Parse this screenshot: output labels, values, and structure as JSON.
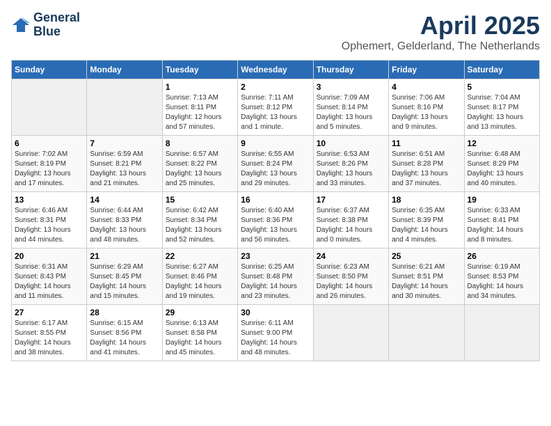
{
  "header": {
    "logo_line1": "General",
    "logo_line2": "Blue",
    "title": "April 2025",
    "subtitle": "Ophemert, Gelderland, The Netherlands"
  },
  "weekdays": [
    "Sunday",
    "Monday",
    "Tuesday",
    "Wednesday",
    "Thursday",
    "Friday",
    "Saturday"
  ],
  "weeks": [
    [
      {
        "num": "",
        "info": ""
      },
      {
        "num": "",
        "info": ""
      },
      {
        "num": "1",
        "info": "Sunrise: 7:13 AM\nSunset: 8:11 PM\nDaylight: 12 hours\nand 57 minutes."
      },
      {
        "num": "2",
        "info": "Sunrise: 7:11 AM\nSunset: 8:12 PM\nDaylight: 13 hours\nand 1 minute."
      },
      {
        "num": "3",
        "info": "Sunrise: 7:09 AM\nSunset: 8:14 PM\nDaylight: 13 hours\nand 5 minutes."
      },
      {
        "num": "4",
        "info": "Sunrise: 7:06 AM\nSunset: 8:16 PM\nDaylight: 13 hours\nand 9 minutes."
      },
      {
        "num": "5",
        "info": "Sunrise: 7:04 AM\nSunset: 8:17 PM\nDaylight: 13 hours\nand 13 minutes."
      }
    ],
    [
      {
        "num": "6",
        "info": "Sunrise: 7:02 AM\nSunset: 8:19 PM\nDaylight: 13 hours\nand 17 minutes."
      },
      {
        "num": "7",
        "info": "Sunrise: 6:59 AM\nSunset: 8:21 PM\nDaylight: 13 hours\nand 21 minutes."
      },
      {
        "num": "8",
        "info": "Sunrise: 6:57 AM\nSunset: 8:22 PM\nDaylight: 13 hours\nand 25 minutes."
      },
      {
        "num": "9",
        "info": "Sunrise: 6:55 AM\nSunset: 8:24 PM\nDaylight: 13 hours\nand 29 minutes."
      },
      {
        "num": "10",
        "info": "Sunrise: 6:53 AM\nSunset: 8:26 PM\nDaylight: 13 hours\nand 33 minutes."
      },
      {
        "num": "11",
        "info": "Sunrise: 6:51 AM\nSunset: 8:28 PM\nDaylight: 13 hours\nand 37 minutes."
      },
      {
        "num": "12",
        "info": "Sunrise: 6:48 AM\nSunset: 8:29 PM\nDaylight: 13 hours\nand 40 minutes."
      }
    ],
    [
      {
        "num": "13",
        "info": "Sunrise: 6:46 AM\nSunset: 8:31 PM\nDaylight: 13 hours\nand 44 minutes."
      },
      {
        "num": "14",
        "info": "Sunrise: 6:44 AM\nSunset: 8:33 PM\nDaylight: 13 hours\nand 48 minutes."
      },
      {
        "num": "15",
        "info": "Sunrise: 6:42 AM\nSunset: 8:34 PM\nDaylight: 13 hours\nand 52 minutes."
      },
      {
        "num": "16",
        "info": "Sunrise: 6:40 AM\nSunset: 8:36 PM\nDaylight: 13 hours\nand 56 minutes."
      },
      {
        "num": "17",
        "info": "Sunrise: 6:37 AM\nSunset: 8:38 PM\nDaylight: 14 hours\nand 0 minutes."
      },
      {
        "num": "18",
        "info": "Sunrise: 6:35 AM\nSunset: 8:39 PM\nDaylight: 14 hours\nand 4 minutes."
      },
      {
        "num": "19",
        "info": "Sunrise: 6:33 AM\nSunset: 8:41 PM\nDaylight: 14 hours\nand 8 minutes."
      }
    ],
    [
      {
        "num": "20",
        "info": "Sunrise: 6:31 AM\nSunset: 8:43 PM\nDaylight: 14 hours\nand 11 minutes."
      },
      {
        "num": "21",
        "info": "Sunrise: 6:29 AM\nSunset: 8:45 PM\nDaylight: 14 hours\nand 15 minutes."
      },
      {
        "num": "22",
        "info": "Sunrise: 6:27 AM\nSunset: 8:46 PM\nDaylight: 14 hours\nand 19 minutes."
      },
      {
        "num": "23",
        "info": "Sunrise: 6:25 AM\nSunset: 8:48 PM\nDaylight: 14 hours\nand 23 minutes."
      },
      {
        "num": "24",
        "info": "Sunrise: 6:23 AM\nSunset: 8:50 PM\nDaylight: 14 hours\nand 26 minutes."
      },
      {
        "num": "25",
        "info": "Sunrise: 6:21 AM\nSunset: 8:51 PM\nDaylight: 14 hours\nand 30 minutes."
      },
      {
        "num": "26",
        "info": "Sunrise: 6:19 AM\nSunset: 8:53 PM\nDaylight: 14 hours\nand 34 minutes."
      }
    ],
    [
      {
        "num": "27",
        "info": "Sunrise: 6:17 AM\nSunset: 8:55 PM\nDaylight: 14 hours\nand 38 minutes."
      },
      {
        "num": "28",
        "info": "Sunrise: 6:15 AM\nSunset: 8:56 PM\nDaylight: 14 hours\nand 41 minutes."
      },
      {
        "num": "29",
        "info": "Sunrise: 6:13 AM\nSunset: 8:58 PM\nDaylight: 14 hours\nand 45 minutes."
      },
      {
        "num": "30",
        "info": "Sunrise: 6:11 AM\nSunset: 9:00 PM\nDaylight: 14 hours\nand 48 minutes."
      },
      {
        "num": "",
        "info": ""
      },
      {
        "num": "",
        "info": ""
      },
      {
        "num": "",
        "info": ""
      }
    ]
  ]
}
